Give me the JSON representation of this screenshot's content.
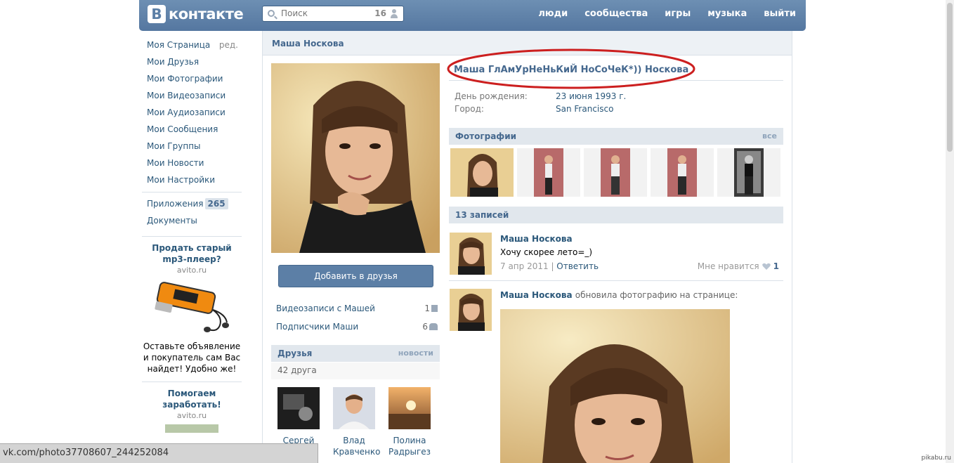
{
  "header": {
    "logo_letter": "В",
    "logo_text": "контакте",
    "search_placeholder": "Поиск",
    "search_count": "16",
    "nav": [
      "люди",
      "сообщества",
      "игры",
      "музыка",
      "выйти"
    ]
  },
  "leftnav": {
    "items": [
      {
        "label": "Моя Страница",
        "extra": "ред."
      },
      {
        "label": "Мои Друзья"
      },
      {
        "label": "Мои Фотографии"
      },
      {
        "label": "Мои Видеозаписи"
      },
      {
        "label": "Мои Аудиозаписи"
      },
      {
        "label": "Мои Сообщения"
      },
      {
        "label": "Мои Группы"
      },
      {
        "label": "Мои Новости"
      },
      {
        "label": "Мои Настройки"
      }
    ],
    "apps_label": "Приложения",
    "apps_count": "265",
    "docs_label": "Документы"
  },
  "ads": [
    {
      "title": "Продать старый mp3-плеер?",
      "domain": "avito.ru",
      "text": "Оставьте объявление и покупатель сам Вас найдет! Удобно же!"
    },
    {
      "title": "Помогаем заработать!",
      "domain": "avito.ru"
    }
  ],
  "profile": {
    "header_name": "Маша Носкова",
    "full_name": "Маша ГлАмУрНеНьКиЙ НоСоЧеК*)) Носкова",
    "birthday_label": "День рождения:",
    "birthday_value": "23 июня 1993 г.",
    "city_label": "Город:",
    "city_value": "San Francisco",
    "add_friend": "Добавить в друзья",
    "videos_label": "Видеозаписи с Машей",
    "videos_count": "1",
    "followers_label": "Подписчики Маши",
    "followers_count": "6",
    "friends_title": "Друзья",
    "friends_link": "новости",
    "friends_count": "42 друга",
    "friends": [
      {
        "name": "Сергей"
      },
      {
        "name": "Влад Кравченко"
      },
      {
        "name": "Полина Радрыгез"
      }
    ],
    "photos_title": "Фотографии",
    "photos_link": "все",
    "wall_title": "13 записей"
  },
  "posts": [
    {
      "author": "Маша Носкова",
      "text": "Хочу скорее лето=_)",
      "date": "7 апр 2011",
      "reply": "Ответить",
      "like_label": "Мне нравится",
      "likes": "1"
    },
    {
      "author": "Маша Носкова",
      "action": "обновила фотографию на странице:"
    }
  ],
  "statusbar": {
    "url": "vk.com/photo37708607_244252084"
  },
  "watermark": "pikabu.ru",
  "colors": {
    "header": "#5b7fa6",
    "link": "#2b587a",
    "highlight_ellipse": "#cc1f1f"
  }
}
